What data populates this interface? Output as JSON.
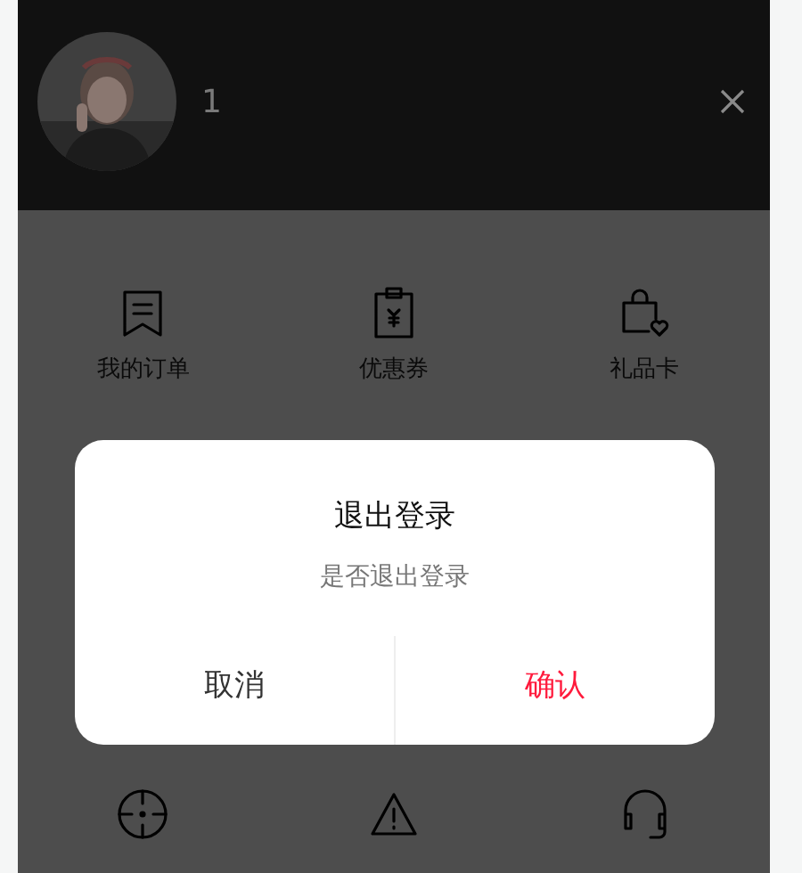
{
  "header": {
    "username": "1"
  },
  "menu": {
    "items": [
      {
        "label": "我的订单"
      },
      {
        "label": "优惠券"
      },
      {
        "label": "礼品卡"
      }
    ]
  },
  "dialog": {
    "title": "退出登录",
    "message": "是否退出登录",
    "buttons": [
      {
        "label": "取消",
        "kind": "cancel"
      },
      {
        "label": "确认",
        "kind": "confirm"
      }
    ]
  }
}
